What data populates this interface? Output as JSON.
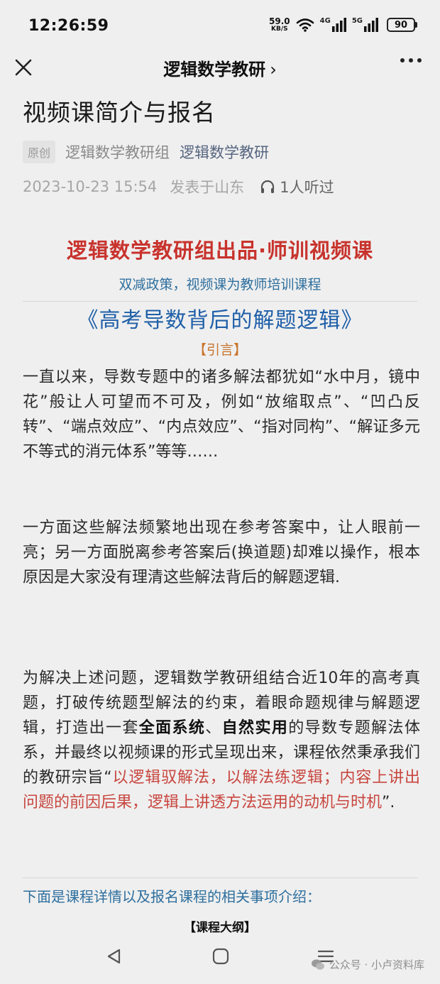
{
  "status_bar": {
    "time": "12:26:59",
    "net_speed_value": "59.0",
    "net_speed_unit": "KB/S",
    "sig1_label": "4G",
    "sig2_label": "5G",
    "battery": "90"
  },
  "nav": {
    "title": "逻辑数学教研",
    "chevron": "›"
  },
  "article": {
    "title": "视频课简介与报名",
    "badge": "原创",
    "author": "逻辑数学教研组",
    "account": "逻辑数学教研",
    "datetime": "2023-10-23 15:54",
    "location": "发表于山东",
    "listen_count": "1人听过"
  },
  "content": {
    "headline": "逻辑数学教研组出品·师训视频课",
    "subhead": "双减政策，视频课为教师培训课程",
    "course_title": "《高考导数背后的解题逻辑》",
    "intro_tag": "【引言】",
    "p1": "一直以来，导数专题中的诸多解法都犹如“水中月，镜中花”般让人可望而不可及，例如“放缩取点”、“凹凸反转”、“端点效应”、“内点效应”、“指对同构”、“解证多元不等式的消元体系”等等……",
    "p2": "一方面这些解法频繁地出现在参考答案中，让人眼前一亮；另一方面脱离参考答案后(换道题)却难以操作，根本原因是大家没有理清这些解法背后的解题逻辑.",
    "p3_a": "为解决上述问题，逻辑数学教研组结合近10年的高考真题，打破传统题型解法的约束，着眼命题规律与解题逻辑，打造出一套",
    "p3_b": "全面系统",
    "p3_c": "、",
    "p3_d": "自然实用",
    "p3_e": "的导数专题解法体系，并最终以视频课的形式呈现出来，课程依然秉承我们的教研宗旨“",
    "p3_quote": "以逻辑驭解法，以解法练逻辑；内容上讲出问题的前因后果，逻辑上讲透方法运用的动机与时机",
    "p3_end": "”.",
    "more_info": "下面是课程详情以及报名课程的相关事项介绍：",
    "outline": "【课程大纲】"
  },
  "watermark": "公众号 · 小卢资料库",
  "icons": {
    "close": "close-icon",
    "more": "more-icon",
    "listen": "headphones-icon",
    "back": "back-triangle-icon",
    "home": "home-square-icon",
    "menu": "menu-lines-icon",
    "wechat": "wechat-icon"
  },
  "colors": {
    "headline": "#c8332d",
    "subhead": "#2e6f9e",
    "course_title": "#1f5fa8",
    "intro_tag": "#c8742d",
    "quote": "#c8463f"
  }
}
